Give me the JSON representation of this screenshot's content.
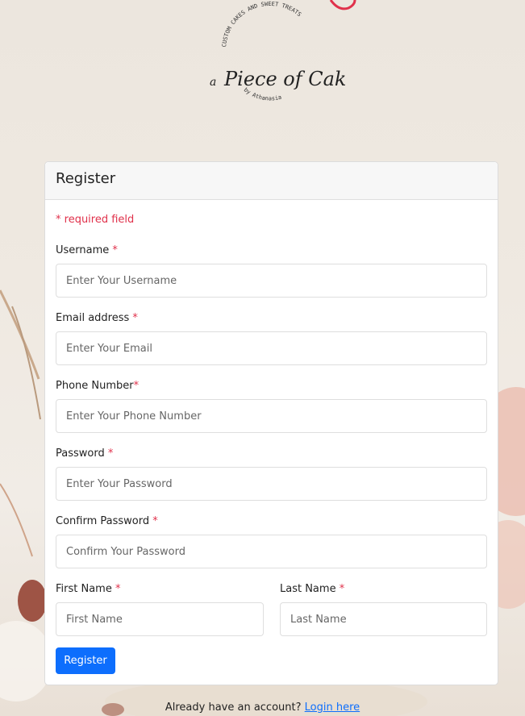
{
  "logo": {
    "text_arc": "CUSTOM CAKES AND SWEET TREATS",
    "brand_a": "a",
    "brand_name": "Piece of Cake",
    "brand_by": "by Athanasia"
  },
  "card": {
    "title": "Register",
    "required_note": "* required field"
  },
  "fields": {
    "username": {
      "label": "Username",
      "required": "*",
      "placeholder": "Enter Your Username"
    },
    "email": {
      "label": "Email address",
      "required": "*",
      "placeholder": "Enter Your Email"
    },
    "phone": {
      "label": "Phone Number",
      "required": "*",
      "placeholder": "Enter Your Phone Number"
    },
    "password": {
      "label": "Password",
      "required": "*",
      "placeholder": "Enter Your Password"
    },
    "confirm_password": {
      "label": "Confirm Password",
      "required": "*",
      "placeholder": "Confirm Your Password"
    },
    "first_name": {
      "label": "First Name",
      "required": "*",
      "placeholder": "First Name"
    },
    "last_name": {
      "label": "Last Name",
      "required": "*",
      "placeholder": "Last Name"
    }
  },
  "register_button": "Register",
  "footer": {
    "text": "Already have an account?",
    "link": "Login here"
  },
  "colors": {
    "accent": "#0d6efd",
    "required": "#e0314b",
    "background": "#ece6de"
  }
}
